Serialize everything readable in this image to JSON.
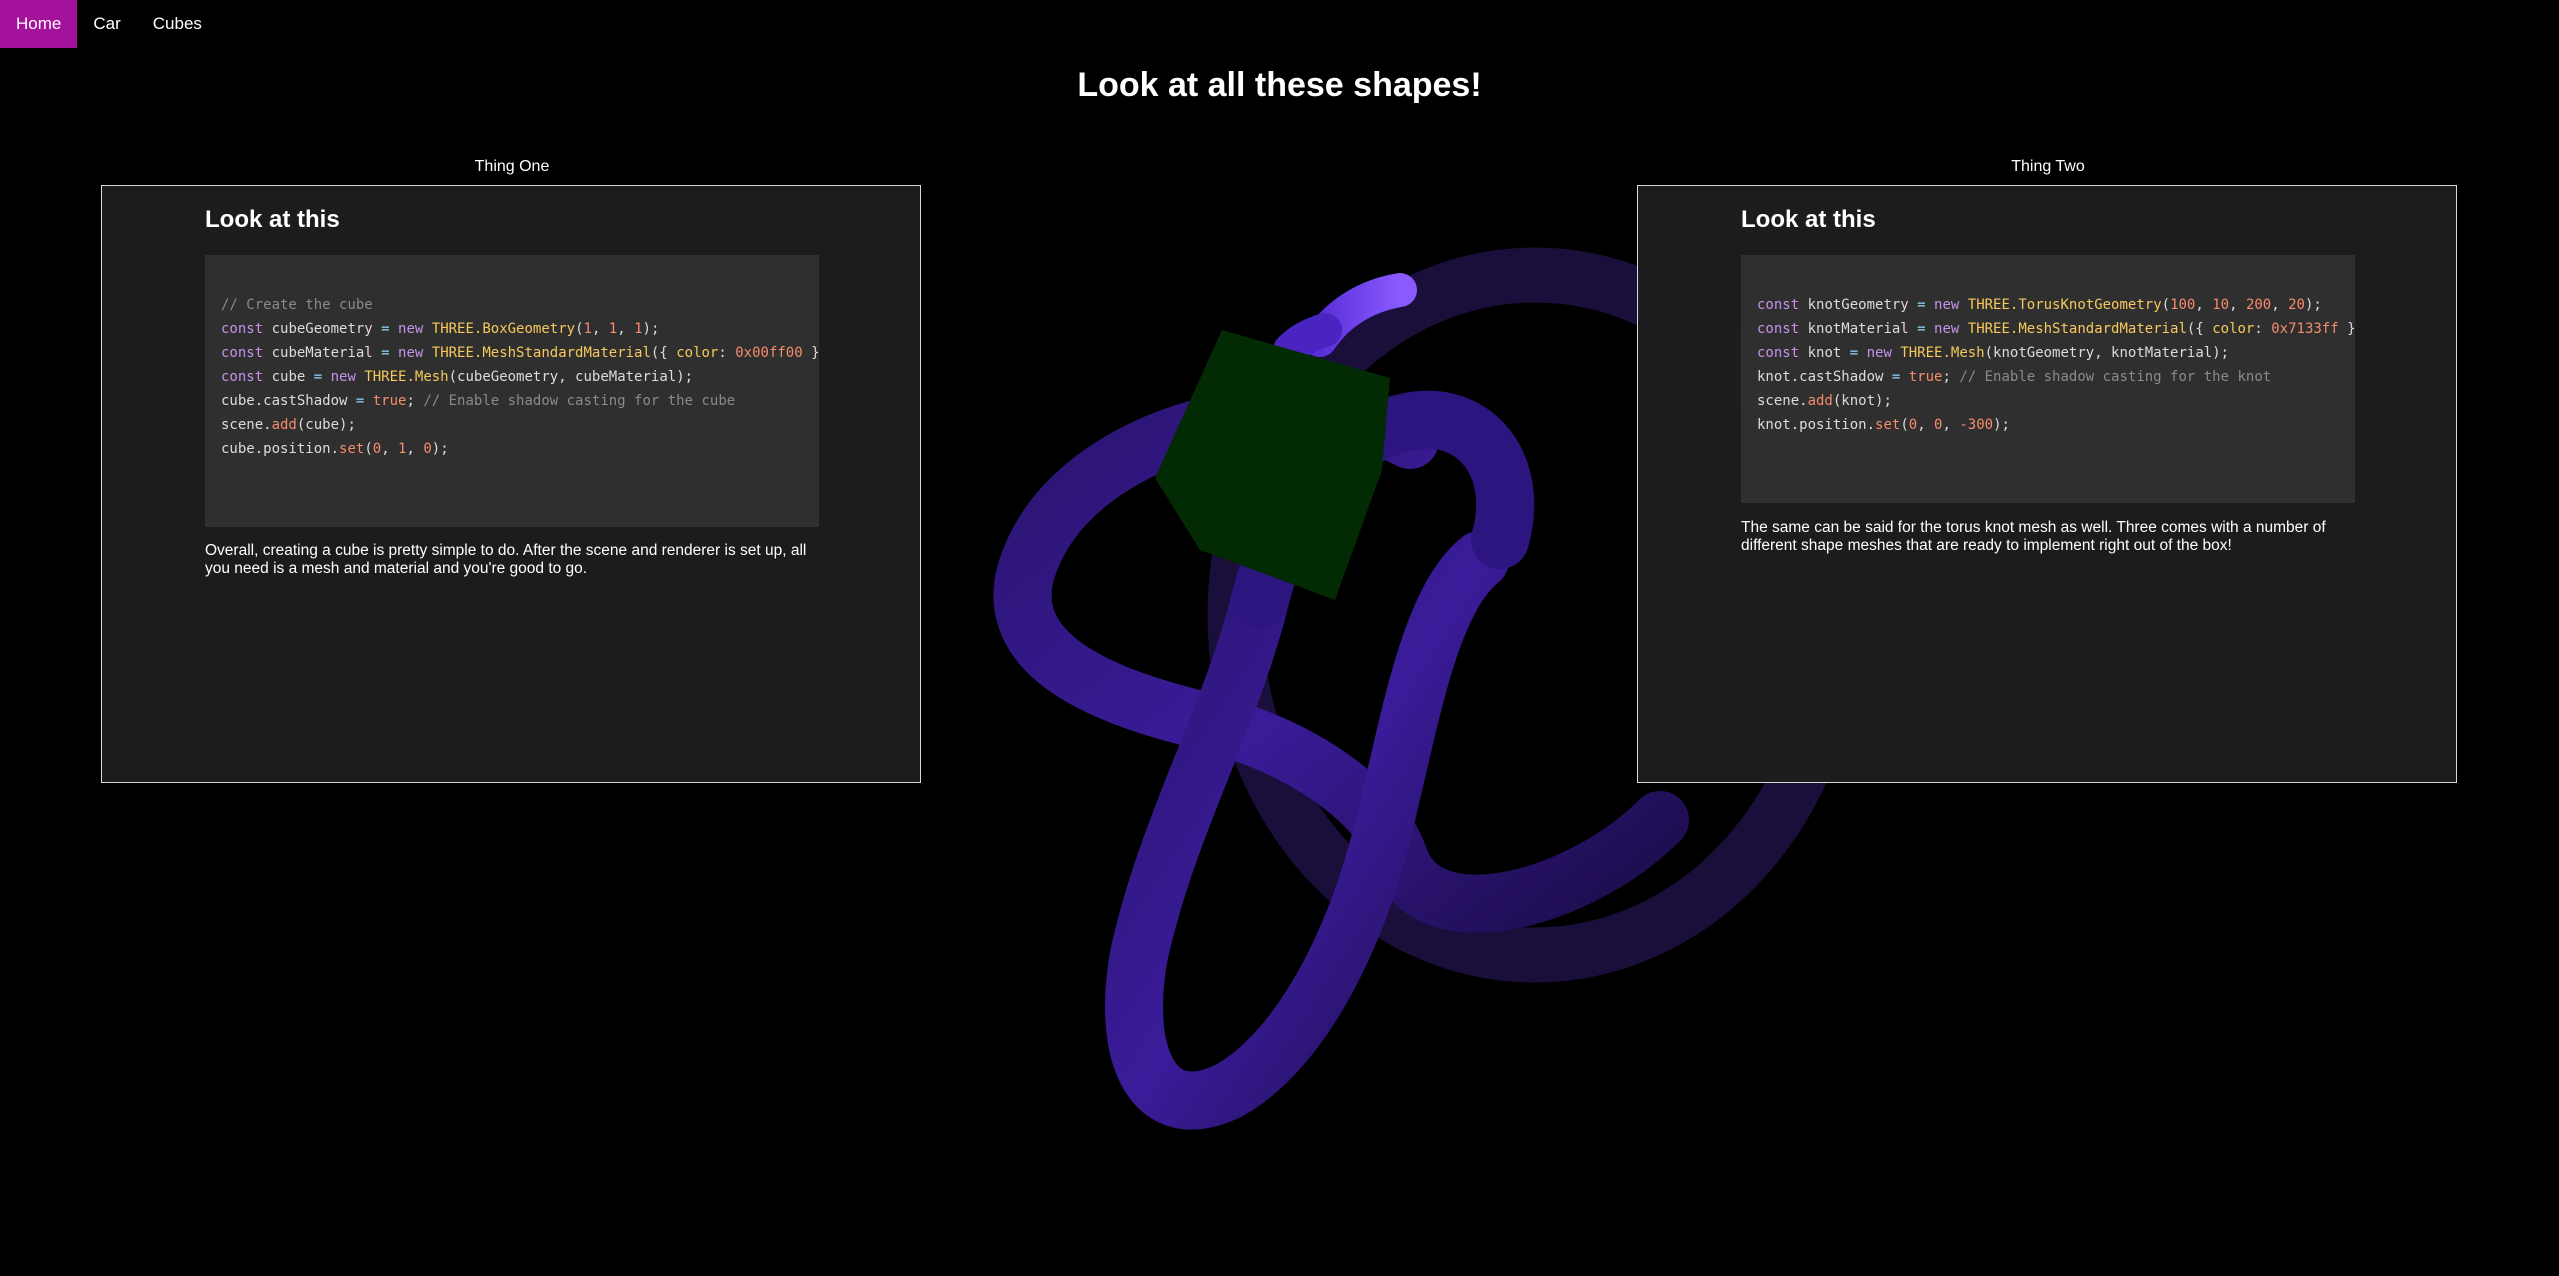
{
  "nav": {
    "items": [
      {
        "label": "Home",
        "active": true
      },
      {
        "label": "Car",
        "active": false
      },
      {
        "label": "Cubes",
        "active": false
      }
    ]
  },
  "page": {
    "title": "Look at all these shapes!"
  },
  "cards": [
    {
      "label": "Thing One",
      "heading": "Look at this",
      "code": [
        [
          [
            "cm",
            "// Create the cube"
          ]
        ],
        [
          [
            "kw",
            "const"
          ],
          [
            "t",
            " cubeGeometry "
          ],
          [
            "op",
            "="
          ],
          [
            "kw",
            " new "
          ],
          [
            "cls",
            "THREE.BoxGeometry"
          ],
          [
            "t",
            "("
          ],
          [
            "num",
            "1"
          ],
          [
            "t",
            ", "
          ],
          [
            "num",
            "1"
          ],
          [
            "t",
            ", "
          ],
          [
            "num",
            "1"
          ],
          [
            "t",
            ");"
          ]
        ],
        [
          [
            "kw",
            "const"
          ],
          [
            "t",
            " cubeMaterial "
          ],
          [
            "op",
            "="
          ],
          [
            "kw",
            " new "
          ],
          [
            "cls",
            "THREE.MeshStandardMaterial"
          ],
          [
            "t",
            "({ "
          ],
          [
            "cls",
            "color"
          ],
          [
            "t",
            ": "
          ],
          [
            "num",
            "0x00ff00"
          ],
          [
            "t",
            " });"
          ]
        ],
        [
          [
            "kw",
            "const"
          ],
          [
            "t",
            " cube "
          ],
          [
            "op",
            "="
          ],
          [
            "kw",
            " new "
          ],
          [
            "cls",
            "THREE.Mesh"
          ],
          [
            "t",
            "(cubeGeometry, cubeMaterial);"
          ]
        ],
        [
          [
            "t",
            "cube.castShadow "
          ],
          [
            "op",
            "="
          ],
          [
            "num",
            " true"
          ],
          [
            "t",
            "; "
          ],
          [
            "cm",
            "// Enable shadow casting for the cube"
          ]
        ],
        [
          [
            "t",
            "scene."
          ],
          [
            "fn",
            "add"
          ],
          [
            "t",
            "(cube);"
          ]
        ],
        [
          [
            "t",
            "cube.position."
          ],
          [
            "fn",
            "set"
          ],
          [
            "t",
            "("
          ],
          [
            "num",
            "0"
          ],
          [
            "t",
            ", "
          ],
          [
            "num",
            "1"
          ],
          [
            "t",
            ", "
          ],
          [
            "num",
            "0"
          ],
          [
            "t",
            ");"
          ]
        ]
      ],
      "description": "Overall, creating a cube is pretty simple to do. After the scene and renderer is set up, all you need is a mesh and material and you're good to go."
    },
    {
      "label": "Thing Two",
      "heading": "Look at this",
      "code": [
        [
          [
            "kw",
            "const"
          ],
          [
            "t",
            " knotGeometry "
          ],
          [
            "op",
            "="
          ],
          [
            "kw",
            " new "
          ],
          [
            "cls",
            "THREE.TorusKnotGeometry"
          ],
          [
            "t",
            "("
          ],
          [
            "num",
            "100"
          ],
          [
            "t",
            ", "
          ],
          [
            "num",
            "10"
          ],
          [
            "t",
            ", "
          ],
          [
            "num",
            "200"
          ],
          [
            "t",
            ", "
          ],
          [
            "num",
            "20"
          ],
          [
            "t",
            ");"
          ]
        ],
        [
          [
            "kw",
            "const"
          ],
          [
            "t",
            " knotMaterial "
          ],
          [
            "op",
            "="
          ],
          [
            "kw",
            " new "
          ],
          [
            "cls",
            "THREE.MeshStandardMaterial"
          ],
          [
            "t",
            "({ "
          ],
          [
            "cls",
            "color"
          ],
          [
            "t",
            ": "
          ],
          [
            "num",
            "0x7133ff"
          ],
          [
            "t",
            " });"
          ]
        ],
        [
          [
            "kw",
            "const"
          ],
          [
            "t",
            " knot "
          ],
          [
            "op",
            "="
          ],
          [
            "kw",
            " new "
          ],
          [
            "cls",
            "THREE.Mesh"
          ],
          [
            "t",
            "(knotGeometry, knotMaterial);"
          ]
        ],
        [
          [
            "t",
            "knot.castShadow "
          ],
          [
            "op",
            "="
          ],
          [
            "num",
            " true"
          ],
          [
            "t",
            "; "
          ],
          [
            "cm",
            "// Enable shadow casting for the knot"
          ]
        ],
        [
          [
            "t",
            "scene."
          ],
          [
            "fn",
            "add"
          ],
          [
            "t",
            "(knot);"
          ]
        ],
        [
          [
            "t",
            "knot.position."
          ],
          [
            "fn",
            "set"
          ],
          [
            "t",
            "("
          ],
          [
            "num",
            "0"
          ],
          [
            "t",
            ", "
          ],
          [
            "num",
            "0"
          ],
          [
            "t",
            ", "
          ],
          [
            "num",
            "-300"
          ],
          [
            "t",
            ");"
          ]
        ]
      ],
      "description": "The same can be said for the torus knot mesh as well. Three comes with a number of different shape meshes that are ready to implement right out of the box!"
    }
  ],
  "colors": {
    "nav_active": "#a4119a",
    "background": "#000000",
    "knot": "#7133ff",
    "cube": "#00ff00"
  }
}
